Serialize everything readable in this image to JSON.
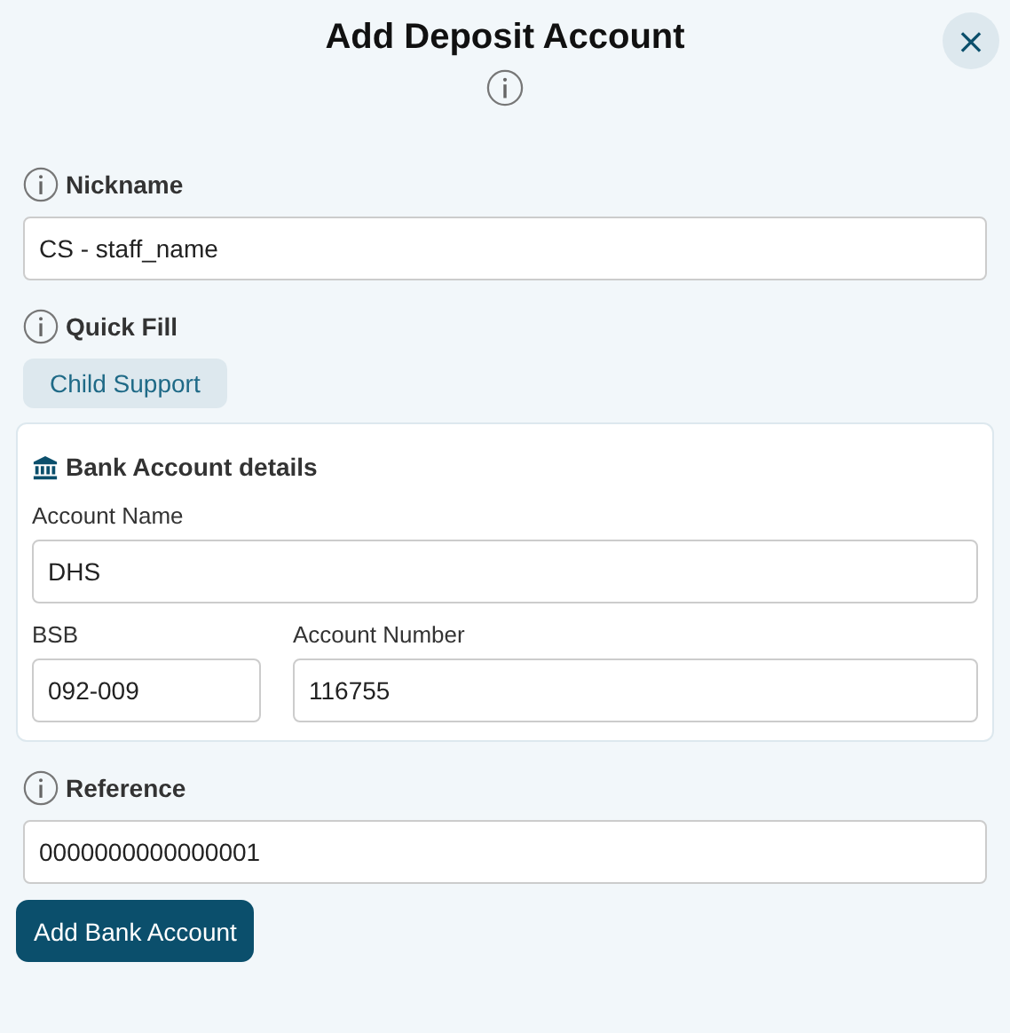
{
  "dialog": {
    "title": "Add Deposit Account",
    "close_glyph": "×"
  },
  "nickname": {
    "label": "Nickname",
    "value": "CS - staff_name"
  },
  "quick_fill": {
    "label": "Quick Fill",
    "options": [
      "Child Support"
    ]
  },
  "bank_details": {
    "title": "Bank Account details",
    "account_name": {
      "label": "Account Name",
      "value": "DHS"
    },
    "bsb": {
      "label": "BSB",
      "value": "092-009"
    },
    "account_number": {
      "label": "Account Number",
      "value": "116755"
    }
  },
  "reference": {
    "label": "Reference",
    "value": "0000000000000001"
  },
  "submit": {
    "label": "Add Bank Account"
  }
}
